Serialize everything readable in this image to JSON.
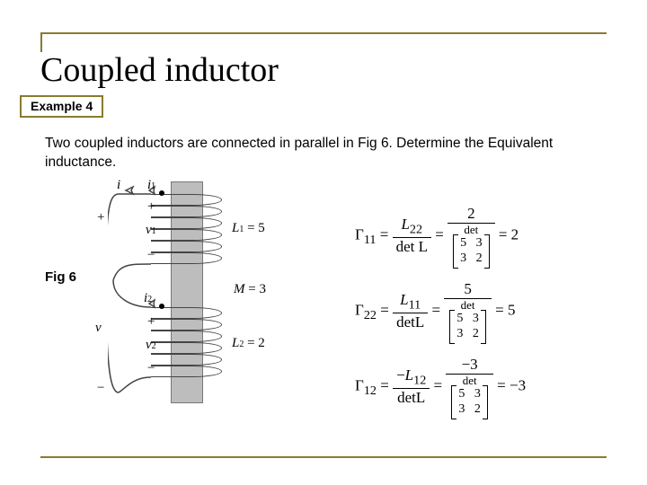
{
  "title": "Coupled inductor",
  "example_label": "Example 4",
  "body": "Two coupled inductors are connected in parallel in Fig 6. Determine the Equivalent inductance.",
  "fig_label": "Fig 6",
  "circuit": {
    "i": "i",
    "i1": "i",
    "i1sub": "1",
    "i2": "i",
    "i2sub": "2",
    "v": "v",
    "v1": "v",
    "v1sub": "1",
    "v2": "v",
    "v2sub": "2",
    "L1": "L",
    "L1sub": "1",
    "L1val": " = 5",
    "L2": "L",
    "L2sub": "2",
    "L2val": " = 2",
    "M": "M",
    "Mval": " = 3",
    "plus": "+",
    "minus": "−"
  },
  "eq": {
    "gamma": "Γ",
    "sub11": "11",
    "sub22": "22",
    "sub12": "12",
    "L": "L",
    "Lsub22": "22",
    "Lsub11": "11",
    "Lsub12": "12",
    "det": "det",
    "dL": "L",
    "n1": "2",
    "r1": "2",
    "n2": "5",
    "r2": "5",
    "n3": "−3",
    "r3": "−3",
    "m_r1": "5   3",
    "m_r2": "3   2",
    "minus": "−",
    "eq": " = "
  }
}
